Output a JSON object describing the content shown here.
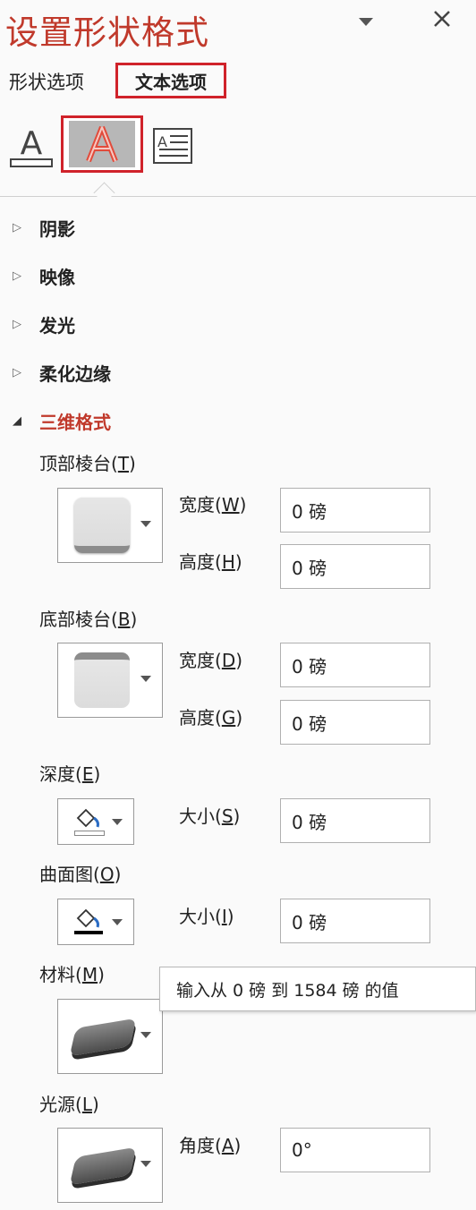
{
  "panel": {
    "title": "设置形状格式",
    "collapse_icon": "chevron-down-icon",
    "close_icon": "close-icon"
  },
  "tabs": [
    {
      "label": "形状选项",
      "active": false
    },
    {
      "label": "文本选项",
      "active": true
    }
  ],
  "icon_tabs": [
    "text-fill-outline-icon",
    "text-effects-icon",
    "textbox-icon"
  ],
  "sections": {
    "shadow": "阴影",
    "reflection": "映像",
    "glow": "发光",
    "soft_edges": "柔化边缘",
    "format_3d": "三维格式"
  },
  "format3d": {
    "top_bevel": {
      "label": "顶部棱台(",
      "key": "T",
      "width_label": "宽度(",
      "width_key": "W",
      "width_value": "0 磅",
      "height_label": "高度(",
      "height_key": "H",
      "height_value": "0 磅"
    },
    "bottom_bevel": {
      "label": "底部棱台(",
      "key": "B",
      "width_label": "宽度(",
      "width_key": "D",
      "width_value": "0 磅",
      "height_label": "高度(",
      "height_key": "G",
      "height_value": "0 磅"
    },
    "depth": {
      "label": "深度(",
      "key": "E",
      "size_label": "大小(",
      "size_key": "S",
      "size_value": "0 磅",
      "color": "#ffffff"
    },
    "contour": {
      "label": "曲面图(",
      "key": "O",
      "size_label": "大小(",
      "size_key": "I",
      "size_value": "0 磅",
      "color": "#000000"
    },
    "material": {
      "label": "材料(",
      "key": "M"
    },
    "lighting": {
      "label": "光源(",
      "key": "L",
      "angle_label": "角度(",
      "angle_key": "A",
      "angle_value": "0°"
    }
  },
  "tooltip": "输入从 0 磅 到 1584 磅 的值",
  "colors": {
    "accent": "#c0392b",
    "highlight_border": "#d0222a"
  }
}
